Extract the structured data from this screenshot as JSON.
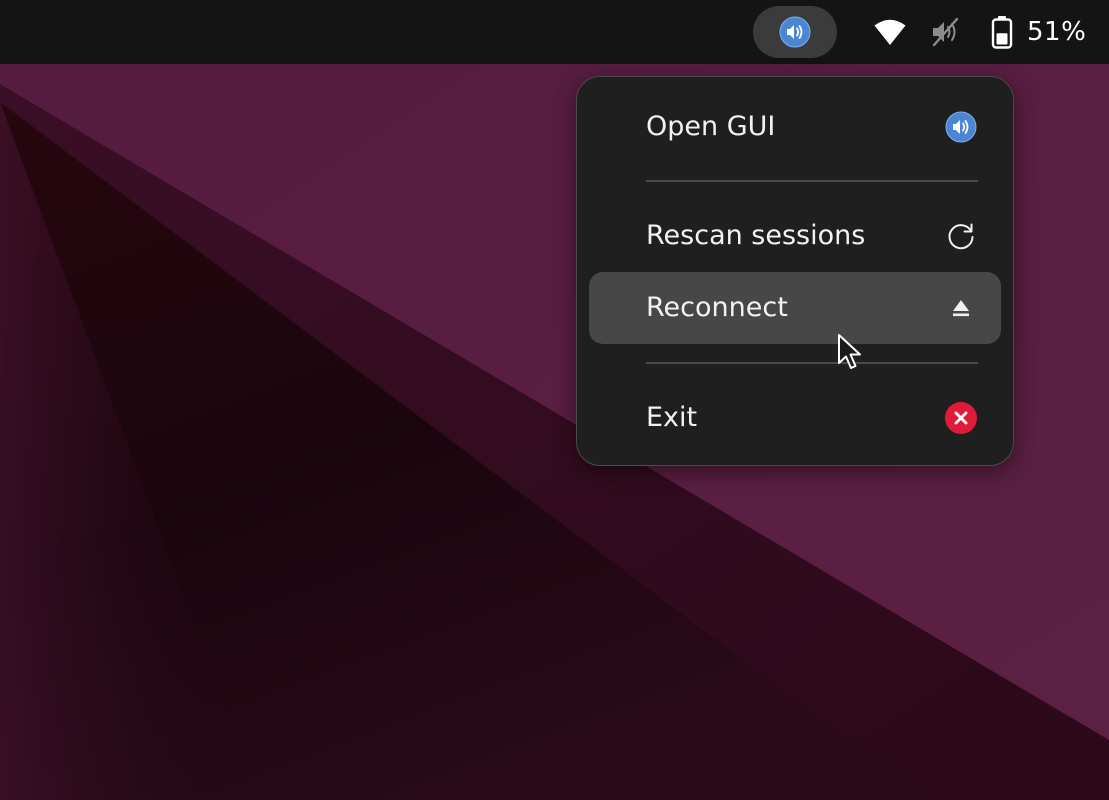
{
  "topbar": {
    "app_indicator_icon": "speaker-volume-icon",
    "wifi_icon": "wifi-icon",
    "sound_icon": "speaker-muted-icon",
    "battery_icon": "battery-icon",
    "battery_level": 0.51,
    "battery_percent": "51%"
  },
  "menu": {
    "items": [
      {
        "label": "Open GUI",
        "icon": "speaker-volume-icon"
      },
      {
        "label": "Rescan sessions",
        "icon": "refresh-icon"
      },
      {
        "label": "Reconnect",
        "icon": "eject-icon",
        "state": "highlighted"
      },
      {
        "label": "Exit",
        "icon": "close-circle-icon"
      }
    ]
  },
  "colors": {
    "topbar": "#141414",
    "menu_background": "#1f1f1f",
    "menu_hover": "#474747",
    "wallpaper_light": "#5a1f42",
    "wallpaper_dark": "#1c0611",
    "speaker_icon": "#4a86d4",
    "exit_icon": "#e01b3a"
  }
}
